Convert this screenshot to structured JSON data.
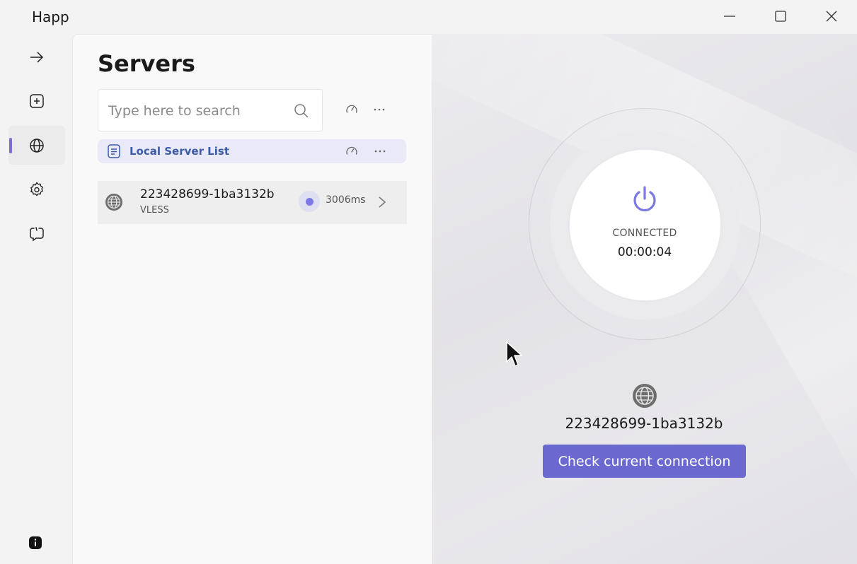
{
  "window": {
    "title": "Happ",
    "controls": [
      "minimize-icon",
      "maximize-icon",
      "close-icon"
    ]
  },
  "nav": {
    "items": [
      {
        "name": "connect",
        "icon": "arrow-right-icon"
      },
      {
        "name": "add",
        "icon": "add-square-icon"
      },
      {
        "name": "servers",
        "icon": "globe-icon",
        "active": true
      },
      {
        "name": "settings",
        "icon": "gear-icon"
      },
      {
        "name": "logs",
        "icon": "chat-bubble-icon"
      }
    ],
    "bottom_icon": "info-icon"
  },
  "servers_panel": {
    "title": "Servers",
    "search": {
      "placeholder": "Type here to search",
      "value": ""
    },
    "group": {
      "label": "Local Server List"
    },
    "server": {
      "name": "223428699-1ba3132b",
      "protocol": "VLESS",
      "ping": "3006ms"
    }
  },
  "connection": {
    "status": "CONNECTED",
    "timer": "00:00:04",
    "server_name": "223428699-1ba3132b",
    "check_button": "Check current connection"
  },
  "colors": {
    "accent": "#7b6ed6",
    "button": "#6b69cf",
    "group_label": "#3b5ca8"
  }
}
